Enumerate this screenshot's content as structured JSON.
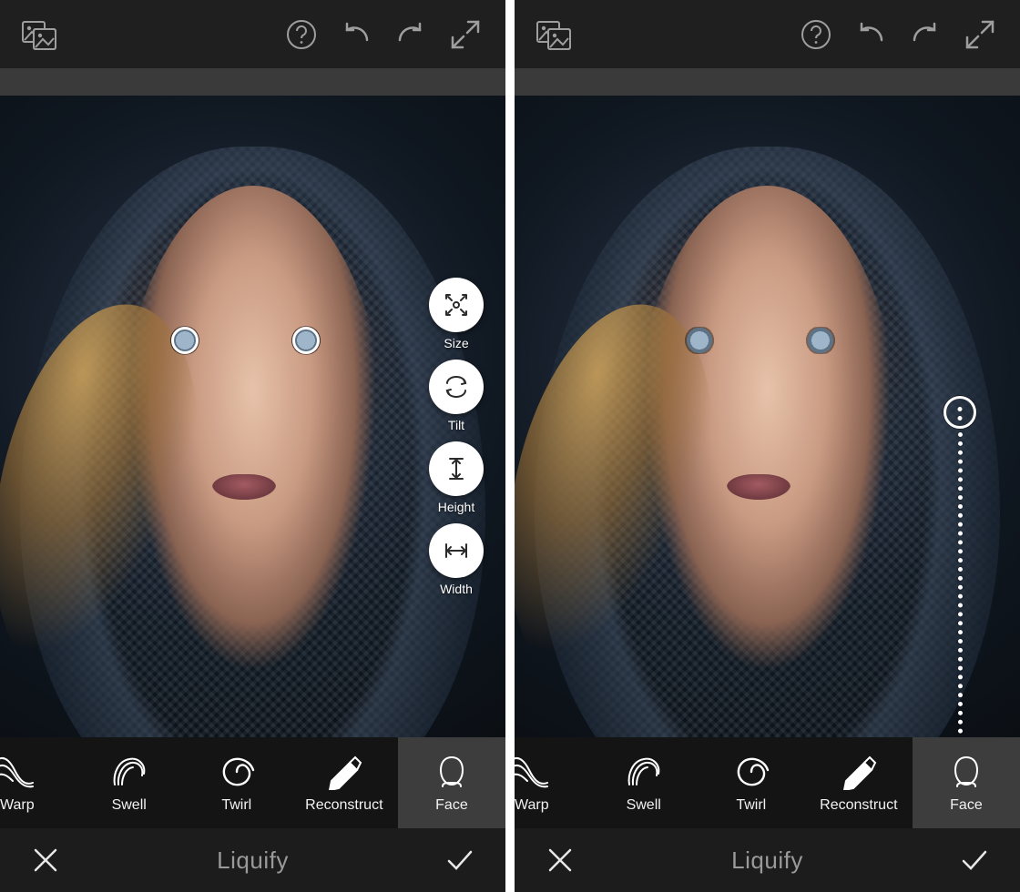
{
  "panels": [
    {
      "topbar": {
        "compare_icon": "compare-icon",
        "help_icon": "help-icon",
        "undo_icon": "undo-icon",
        "redo_icon": "redo-icon",
        "fullscreen_icon": "expand-icon"
      },
      "face_options": [
        {
          "id": "size",
          "label": "Size",
          "icon": "size-icon"
        },
        {
          "id": "tilt",
          "label": "Tilt",
          "icon": "tilt-icon"
        },
        {
          "id": "height",
          "label": "Height",
          "icon": "height-icon"
        },
        {
          "id": "width",
          "label": "Width",
          "icon": "width-icon"
        }
      ],
      "eye_markers": true,
      "tools": [
        {
          "id": "warp",
          "label": "Warp",
          "icon": "warp-icon",
          "active": false,
          "truncated": true
        },
        {
          "id": "swell",
          "label": "Swell",
          "icon": "swell-icon",
          "active": false
        },
        {
          "id": "twirl",
          "label": "Twirl",
          "icon": "twirl-icon",
          "active": false
        },
        {
          "id": "reconstruct",
          "label": "Reconstruct",
          "icon": "reconstruct-icon",
          "active": false
        },
        {
          "id": "face",
          "label": "Face",
          "icon": "face-icon",
          "active": true
        }
      ],
      "actionbar": {
        "title": "Liquify",
        "cancel_icon": "close-icon",
        "accept_icon": "check-icon"
      }
    },
    {
      "topbar": {
        "compare_icon": "compare-icon",
        "help_icon": "help-icon",
        "undo_icon": "undo-icon",
        "redo_icon": "redo-icon",
        "fullscreen_icon": "expand-icon"
      },
      "slider": {
        "visible": true
      },
      "tools": [
        {
          "id": "warp",
          "label": "Warp",
          "icon": "warp-icon",
          "active": false,
          "truncated": true
        },
        {
          "id": "swell",
          "label": "Swell",
          "icon": "swell-icon",
          "active": false
        },
        {
          "id": "twirl",
          "label": "Twirl",
          "icon": "twirl-icon",
          "active": false
        },
        {
          "id": "reconstruct",
          "label": "Reconstruct",
          "icon": "reconstruct-icon",
          "active": false
        },
        {
          "id": "face",
          "label": "Face",
          "icon": "face-icon",
          "active": true
        }
      ],
      "actionbar": {
        "title": "Liquify",
        "cancel_icon": "close-icon",
        "accept_icon": "check-icon"
      }
    }
  ],
  "colors": {
    "toolbar": "#1f1f1f",
    "strip": "#3a3a3a",
    "toolrow": "#141414",
    "active": "#3d3d3d",
    "accentCircle": "#ffffff"
  }
}
